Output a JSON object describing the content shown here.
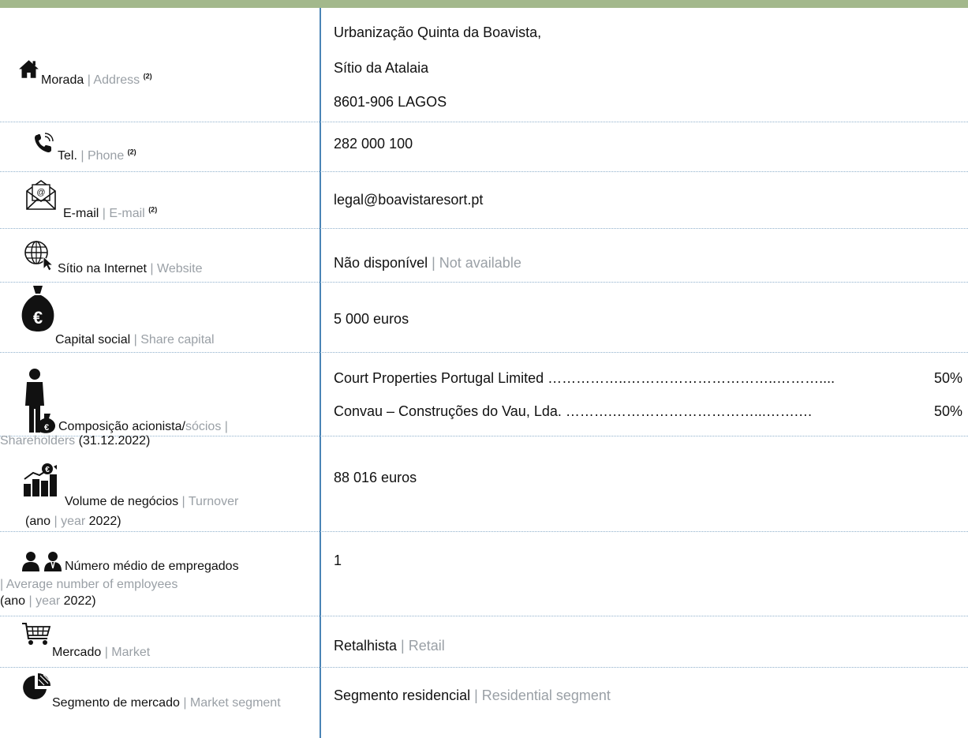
{
  "rows": {
    "address": {
      "label": "Morada",
      "label_en": "Address",
      "note": "(2)",
      "icon": "house-icon",
      "lines": [
        "Urbanização Quinta da Boavista,",
        "Sítio da Atalaia",
        "8601-906 LAGOS"
      ]
    },
    "phone": {
      "label": "Tel.",
      "label_en": "Phone",
      "note": "(2)",
      "icon": "phone-icon",
      "value": "282 000 100"
    },
    "email": {
      "label": "E-mail",
      "label_en": "E-mail",
      "note": "(2)",
      "icon": "envelope-icon",
      "value": "legal@boavistaresort.pt"
    },
    "website": {
      "label": "Sítio na Internet",
      "label_en": "Website",
      "icon": "globe-cursor-icon",
      "value": "Não disponível",
      "value_en": "Not available"
    },
    "capital": {
      "label": "Capital social",
      "label_en": "Share capital",
      "icon": "euro-money-bag-icon",
      "value": "5 000 euros"
    },
    "shareholders": {
      "label": "Composição acionista/",
      "label_mid": "sócios",
      "label_en": "Shareholders",
      "date": "(31.12.2022)",
      "icon": "person-money-bag-icon",
      "items": [
        {
          "name": "Court Properties Portugal Limited ……………..…………………………..……….... ",
          "pct": "50%"
        },
        {
          "name": "Convau – Construções do Vau, Lda. ……….…………………………...…….… ",
          "pct": "50%"
        }
      ]
    },
    "turnover": {
      "label": "Volume de negócios",
      "label_en": "Turnover",
      "year_pre": "(ano",
      "year_en": "year",
      "year": "2022)",
      "icon": "bar-chart-euro-icon",
      "value": "88 016 euros"
    },
    "employees": {
      "label": "Número médio de empregados",
      "label_en": "Average number of employees",
      "year_pre": "(ano",
      "year_en": "year",
      "year": "2022)",
      "icon": "people-icon",
      "value": "1"
    },
    "market": {
      "label": "Mercado",
      "label_en": "Market",
      "icon": "shopping-cart-icon",
      "value": "Retalhista",
      "value_en": "Retail"
    },
    "segment": {
      "label": "Segmento de mercado",
      "label_en": "Market segment",
      "icon": "pie-chart-icon",
      "value": "Segmento residencial",
      "value_en": "Residential segment"
    }
  },
  "colors": {
    "header_bar": "#a3b88c",
    "divider": "#4a84b6",
    "secondary_text": "#9aa0a6"
  }
}
